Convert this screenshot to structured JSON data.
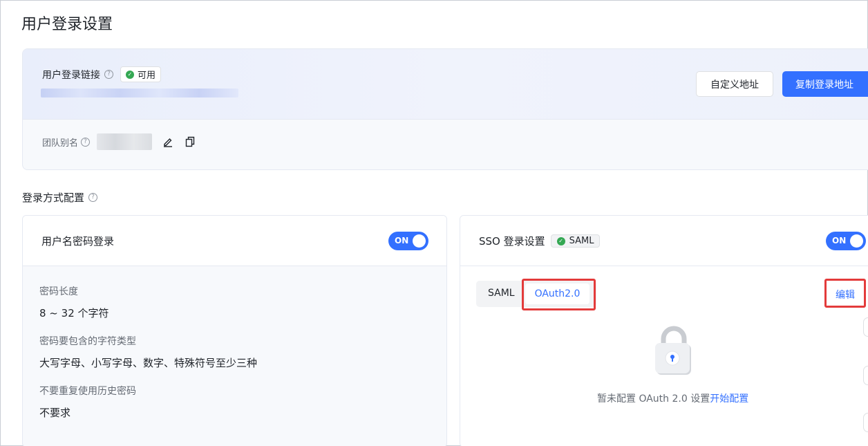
{
  "page": {
    "title": "用户登录设置"
  },
  "login_link": {
    "label": "用户登录链接",
    "status": "可用",
    "custom_button": "自定义地址",
    "copy_button": "复制登录地址",
    "alias_label": "团队别名"
  },
  "login_methods": {
    "section_title": "登录方式配置",
    "password_card": {
      "title": "用户名密码登录",
      "toggle": "ON",
      "fields": [
        {
          "label": "密码长度",
          "value": "8 ~ 32 个字符"
        },
        {
          "label": "密码要包含的字符类型",
          "value": "大写字母、小写字母、数字、特殊符号至少三种"
        },
        {
          "label": "不要重复使用历史密码",
          "value": "不要求"
        }
      ]
    },
    "sso_card": {
      "title": "SSO 登录设置",
      "badge": "SAML",
      "toggle": "ON",
      "tabs": [
        "SAML",
        "OAuth2.0"
      ],
      "edit_link": "编辑",
      "empty_text": "暂未配置 OAuth 2.0 设置",
      "empty_link": "开始配置"
    }
  },
  "colors": {
    "accent": "#3370ff",
    "success": "#34a853",
    "highlight": "#e33b3b"
  }
}
